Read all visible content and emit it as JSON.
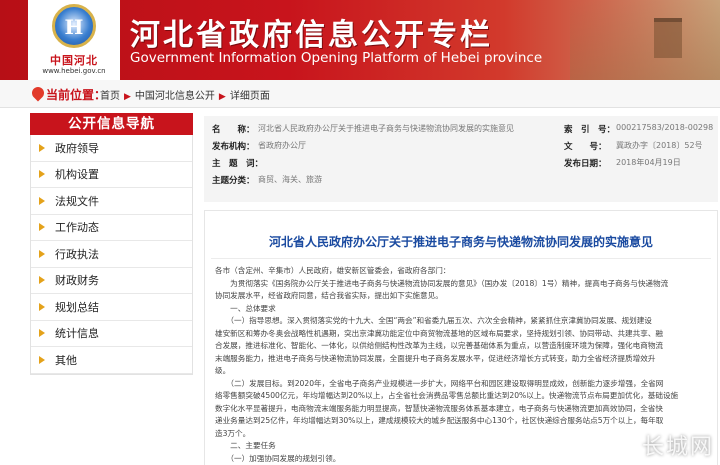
{
  "header": {
    "logo_cn": "中国河北",
    "logo_url": "www.hebei.gov.cn",
    "title": "河北省政府信息公开专栏",
    "subtitle": "Government Information Opening Platform of Hebei province"
  },
  "location": {
    "label": "当前位置：",
    "crumbs": [
      "首页",
      "中国河北信息公开",
      "详细页面"
    ]
  },
  "sidebar": {
    "title": "公开信息导航",
    "items": [
      "政府领导",
      "机构设置",
      "法规文件",
      "工作动态",
      "行政执法",
      "财政财务",
      "规划总结",
      "统计信息",
      "其他"
    ]
  },
  "meta": {
    "name_label": "名　　称：",
    "name_value": "河北省人民政府办公厅关于推进电子商务与快递物流协同发展的实施意见",
    "index_label": "索　引　号：",
    "index_value": "000217583/2018-00298",
    "org_label": "发布机构：",
    "org_value": "省政府办公厅",
    "docno_label": "文　　号：",
    "docno_value": "冀政办字〔2018〕52号",
    "keywords_label": "主　题　词：",
    "keywords_value": "",
    "date_label": "发布日期：",
    "date_value": "2018年04月19日",
    "category_label": "主题分类：",
    "category_value": "商贸、海关、旅游"
  },
  "article": {
    "title": "河北省人民政府办公厅关于推进电子商务与快递物流协同发展的实施意见",
    "lines": [
      "各市（含定州、辛集市）人民政府，雄安新区管委会，省政府各部门：",
      "　　为贯彻落实《国务院办公厅关于推进电子商务与快递物流协同发展的意见》（国办发〔2018〕1号）精神，提高电子商务与快递物流",
      "协同发展水平，经省政府同意，结合我省实际，提出如下实施意见。",
      "　　一、总体要求",
      "　　（一）指导思想。深入贯彻落实党的十九大、全国“两会”和省委九届五次、六次全会精神，紧紧抓住京津冀协同发展、规划建设",
      "雄安新区和筹办冬奥会战略性机遇期，突出京津冀功能定位中商贸物流基地的区域布局要求，坚持规划引领、协同带动、共建共享、融",
      "合发展，推进标准化、智能化、一体化，以供给侧结构性改革为主线，以完善基础体系为重点，以营造制度环境为保障，强化电商物流",
      "末端服务能力，推进电子商务与快递物流协同发展，全面提升电子商务发展水平，促进经济增长方式转变，助力全省经济提质增效升",
      "级。",
      "　　（二）发展目标。到2020年，全省电子商务产业规模进一步扩大，网络平台和园区建设取得明显成效，创新能力逐步增强，全省网",
      "络零售额突破4500亿元，年均增幅达到20%以上，占全省社会消费品零售总额比重达到20%以上。快递物流节点布局更加优化，基础设施",
      "数字化水平显著提升，电商物流末端服务能力明显提高，智慧快递物流服务体系基本建立，电子商务与快递物流更加高效协同，全省快",
      "递业务量达到25亿件，年均增幅达到30%以上，建成规模较大的城乡配送服务中心130个，社区快递综合服务站点5万个以上，每年取",
      "造3万个。",
      "　　二、主要任务",
      "　　（一）加强协同发展的规划引领。"
    ]
  },
  "watermark": "长城网"
}
